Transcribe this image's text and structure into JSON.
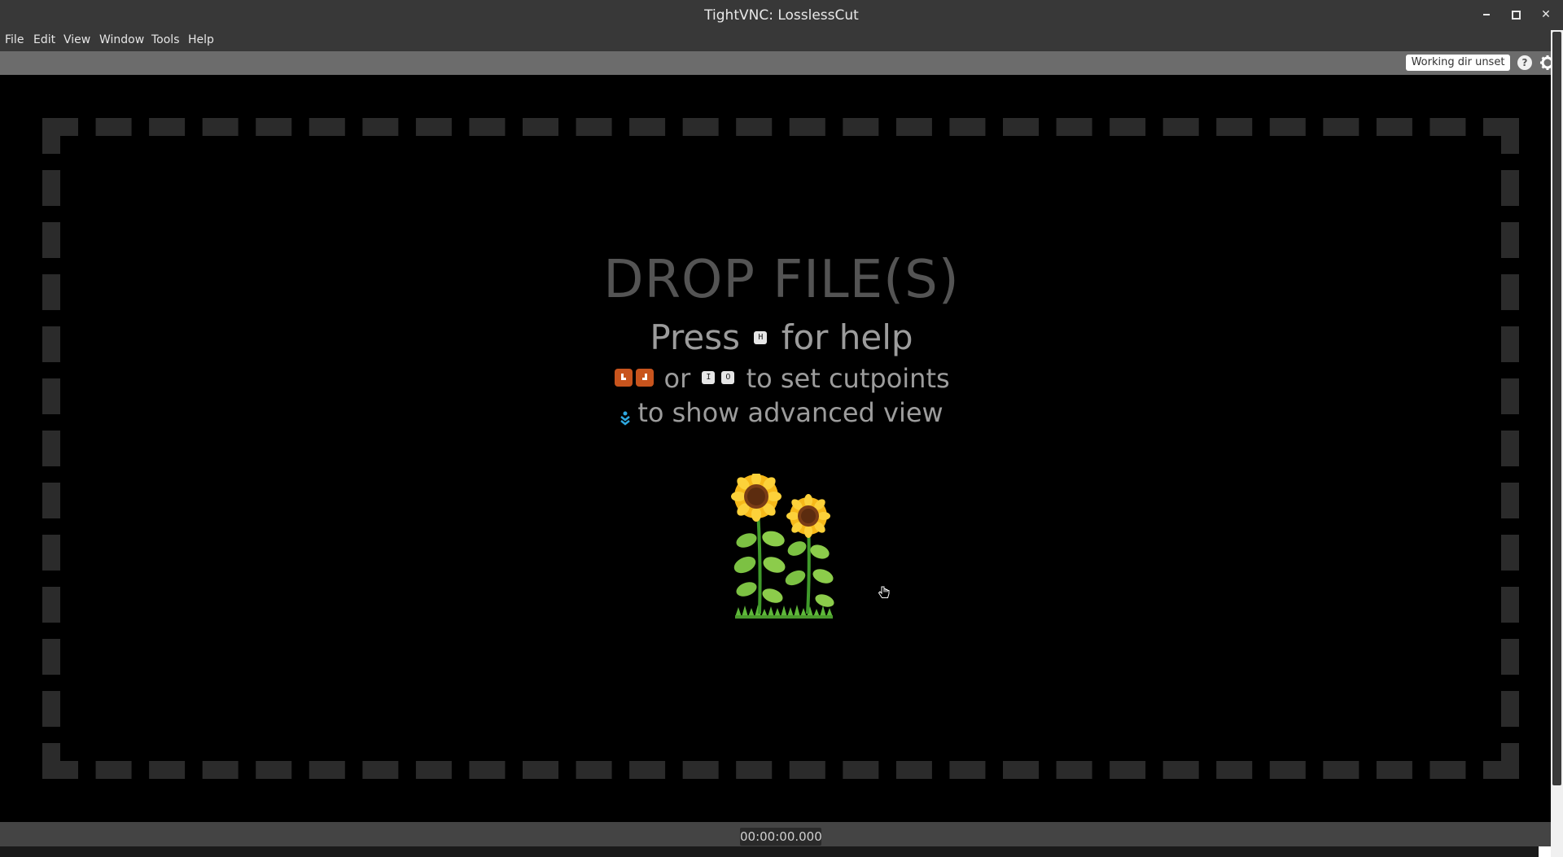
{
  "window": {
    "title": "TightVNC: LosslessCut"
  },
  "menu": {
    "items": [
      {
        "label": "File"
      },
      {
        "label": "Edit"
      },
      {
        "label": "View"
      },
      {
        "label": "Window"
      },
      {
        "label": "Tools"
      },
      {
        "label": "Help"
      }
    ]
  },
  "toolbar": {
    "working_dir_label": "Working dir unset",
    "help_label": "?",
    "settings_icon": "gear-icon"
  },
  "drop_area": {
    "title": "DROP FILE(S)",
    "help_hint": {
      "prefix": "Press",
      "key": "H",
      "suffix": "for help"
    },
    "cutpoint_hint": {
      "or_text": "or",
      "key_in": "I",
      "key_out": "O",
      "suffix": "to set cutpoints"
    },
    "advanced_hint": {
      "suffix": "to show advanced view"
    },
    "illustration": "sunflowers"
  },
  "timeline": {
    "timecode": "00:00:00.000"
  },
  "colors": {
    "titlebar": "#383838",
    "toolbar": "#6c6c6c",
    "main_bg": "#000000",
    "dash": "#2b2b2b",
    "cut_icon": "#c8541d",
    "advanced_icon": "#2ea8e0"
  }
}
